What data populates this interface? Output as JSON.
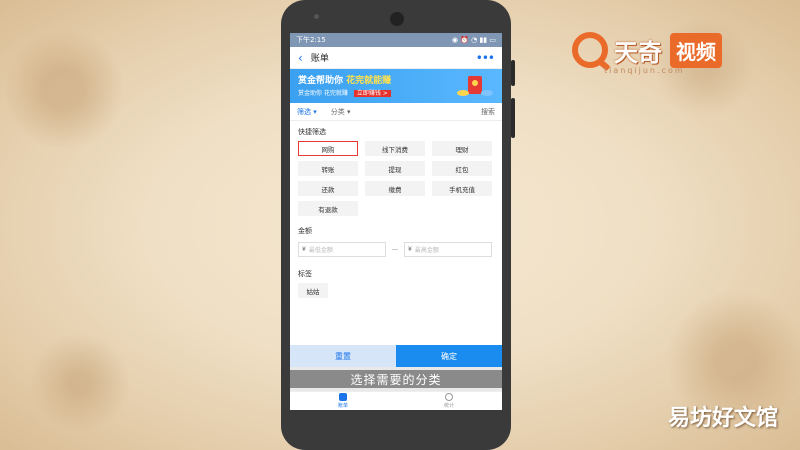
{
  "branding": {
    "logo_name": "天奇",
    "logo_video": "视频",
    "logo_url": "tianqijun.com",
    "watermark": "易坊好文馆",
    "accent_color": "#ea6a2a"
  },
  "status_bar": {
    "time": "下午2:15",
    "icons": [
      "camera-icon",
      "alarm-icon",
      "wifi-icon",
      "signal-icon",
      "battery-icon"
    ]
  },
  "header": {
    "back_icon": "chevron-left-icon",
    "title": "账单",
    "more_label": "•••"
  },
  "banner": {
    "line1_prefix": "赏金帮助你",
    "line1_highlight": "花完就能赚",
    "line2": "赏金助你 花完就赚",
    "button": "立即赚钱 >"
  },
  "filter_bar": {
    "filter": "筛选",
    "category": "分类",
    "search": "搜索"
  },
  "quick_filter": {
    "label": "快捷筛选",
    "chips": [
      {
        "label": "网购",
        "selected": true
      },
      {
        "label": "线下消费",
        "selected": false
      },
      {
        "label": "理财",
        "selected": false
      },
      {
        "label": "转账",
        "selected": false
      },
      {
        "label": "提现",
        "selected": false
      },
      {
        "label": "红包",
        "selected": false
      },
      {
        "label": "还款",
        "selected": false
      },
      {
        "label": "缴费",
        "selected": false
      },
      {
        "label": "手机充值",
        "selected": false
      },
      {
        "label": "有退款",
        "selected": false
      }
    ]
  },
  "amount": {
    "label": "金额",
    "currency": "¥",
    "min_placeholder": "最低金额",
    "max_placeholder": "最高金额"
  },
  "tags": {
    "label": "标签",
    "items": [
      "姑姑"
    ]
  },
  "actions": {
    "reset": "重置",
    "confirm": "确定"
  },
  "caption": "选择需要的分类",
  "tabbar": {
    "tabs": [
      {
        "label": "账单",
        "active": true
      },
      {
        "label": "统计",
        "active": false
      }
    ]
  }
}
